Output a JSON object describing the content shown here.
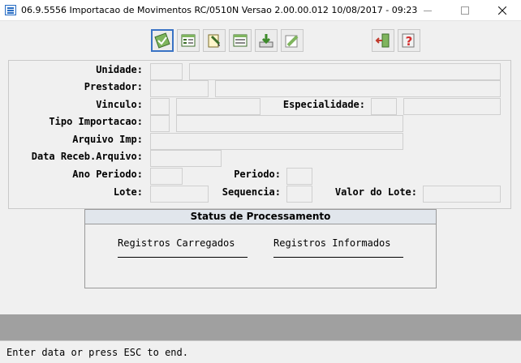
{
  "window": {
    "title": "06.9.5556 Importacao de  Movimentos RC/0510N Versao 2.00.00.012 10/08/2017 - 09:23"
  },
  "toolbar": {
    "buttons": [
      {
        "name": "confirm-icon",
        "active": true
      },
      {
        "name": "records-list-icon"
      },
      {
        "name": "edit-note-icon"
      },
      {
        "name": "table-view-icon"
      },
      {
        "name": "import-download-icon"
      },
      {
        "name": "ruler-tool-icon"
      },
      {
        "name": "exit-door-icon"
      },
      {
        "name": "help-question-icon"
      }
    ]
  },
  "form": {
    "unidade": {
      "label": "Unidade:",
      "code": "",
      "desc": ""
    },
    "prestador": {
      "label": "Prestador:",
      "code": "",
      "desc": ""
    },
    "vinculo": {
      "label": "Vinculo:",
      "code": "",
      "desc": ""
    },
    "especialidade": {
      "label": "Especialidade:",
      "code": "",
      "desc": ""
    },
    "tipo_importacao": {
      "label": "Tipo Importacao:",
      "code": "",
      "desc": ""
    },
    "arquivo_imp": {
      "label": "Arquivo Imp:",
      "value": ""
    },
    "data_receb_arquivo": {
      "label": "Data Receb.Arquivo:",
      "value": ""
    },
    "ano_periodo": {
      "label": "Ano Periodo:",
      "value": ""
    },
    "periodo": {
      "label": "Periodo:",
      "value": ""
    },
    "lote": {
      "label": "Lote:",
      "value": ""
    },
    "sequencia": {
      "label": "Sequencia:",
      "value": ""
    },
    "valor_do_lote": {
      "label": "Valor do Lote:",
      "value": ""
    }
  },
  "status": {
    "title": "Status de Processamento",
    "registros_carregados": "Registros Carregados",
    "registros_informados": "Registros Informados"
  },
  "statusbar": {
    "message": "Enter data or press ESC to end."
  }
}
